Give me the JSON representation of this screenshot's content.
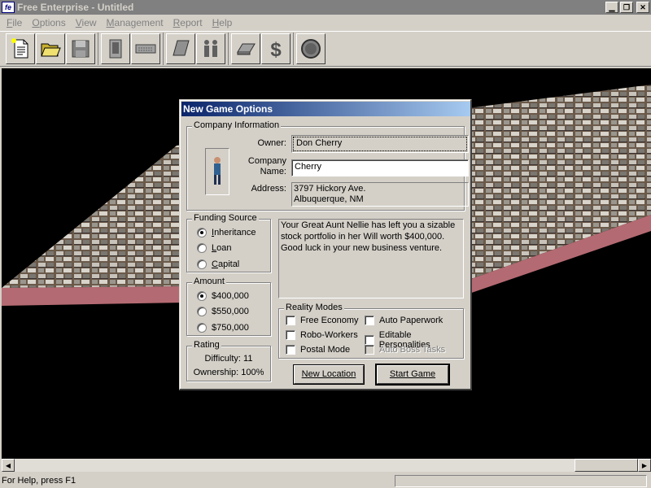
{
  "window": {
    "title": "Free Enterprise - Untitled"
  },
  "menu": {
    "items": [
      "File",
      "Options",
      "View",
      "Management",
      "Report",
      "Help"
    ]
  },
  "toolbar": {
    "buttons": [
      "new-document-icon",
      "open-folder-icon",
      "save-disk-icon",
      "phone-icon",
      "keyboard-icon",
      "book-icon",
      "people-icon",
      "tile-icon",
      "dollar-icon",
      "globe-icon"
    ]
  },
  "status": {
    "help": "For Help, press F1"
  },
  "dialog": {
    "title": "New Game Options",
    "company_info": {
      "label": "Company Information",
      "owner_label": "Owner:",
      "owner_value": "Don Cherry",
      "company_label_1": "Company",
      "company_label_2": "Name:",
      "company_value": "Cherry",
      "address_label": "Address:",
      "address_line1": "3797 Hickory Ave.",
      "address_line2": "Albuquerque, NM"
    },
    "funding": {
      "label": "Funding Source",
      "options": [
        "Inheritance",
        "Loan",
        "Capital"
      ],
      "selected": 0,
      "description": "Your Great Aunt Nellie has left you a sizable stock portfolio in her Will worth $400,000. Good luck in your new business venture."
    },
    "amount": {
      "label": "Amount",
      "options": [
        "$400,000",
        "$550,000",
        "$750,000"
      ],
      "selected": 0
    },
    "rating": {
      "label": "Rating",
      "difficulty": "Difficulty: 11",
      "ownership": "Ownership: 100%"
    },
    "reality": {
      "label": "Reality Modes",
      "left": [
        "Free Economy",
        "Robo-Workers",
        "Postal Mode"
      ],
      "right": [
        "Auto Paperwork",
        "Editable Personalities",
        "Auto Boss Tasks"
      ]
    },
    "buttons": {
      "new_location": "New Location",
      "start_game": "Start Game"
    }
  },
  "colors": {
    "title_active_start": "#0a246a",
    "title_active_end": "#a6caf0",
    "face": "#d4d0c8",
    "viewport": "#000000",
    "terrain_side": "#b46a72"
  }
}
